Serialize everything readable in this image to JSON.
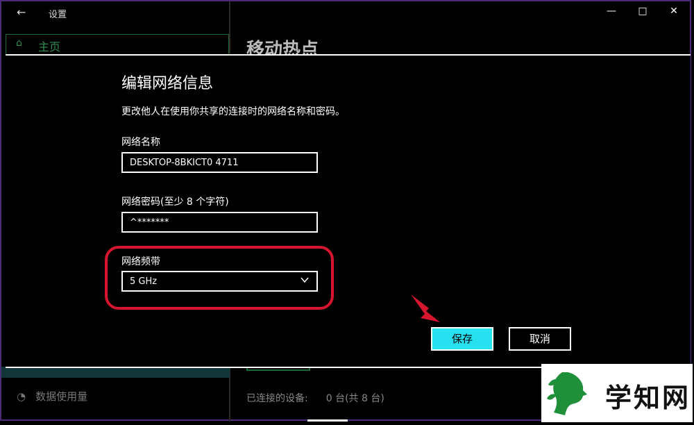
{
  "window": {
    "back_icon": "←",
    "title": "设置",
    "minimize": "—",
    "maximize": "□",
    "close": "✕"
  },
  "sidebar": {
    "home_icon": "⌂",
    "home_label": "主页",
    "data_usage_icon": "◔",
    "data_usage_label": "数据使用量"
  },
  "main": {
    "page_title": "移动热点",
    "connected_label": "已连接的设备:",
    "connected_value": "0 台(共 8 台)"
  },
  "dialog": {
    "title": "编辑网络信息",
    "description": "更改他人在使用你共享的连接时的网络名称和密码。",
    "name_label": "网络名称",
    "name_value": "DESKTOP-8BKICT0 4711",
    "password_label": "网络密码(至少 8 个字符)",
    "password_value": "^*******",
    "band_label": "网络频带",
    "band_value": "5 GHz",
    "save_label": "保存",
    "cancel_label": "取消"
  },
  "watermark": {
    "text": "学知网"
  },
  "colors": {
    "accent": "#27e0f0",
    "highlight": "#d6162e",
    "green": "#2f8f55",
    "logo_green": "#1f8f3a"
  }
}
